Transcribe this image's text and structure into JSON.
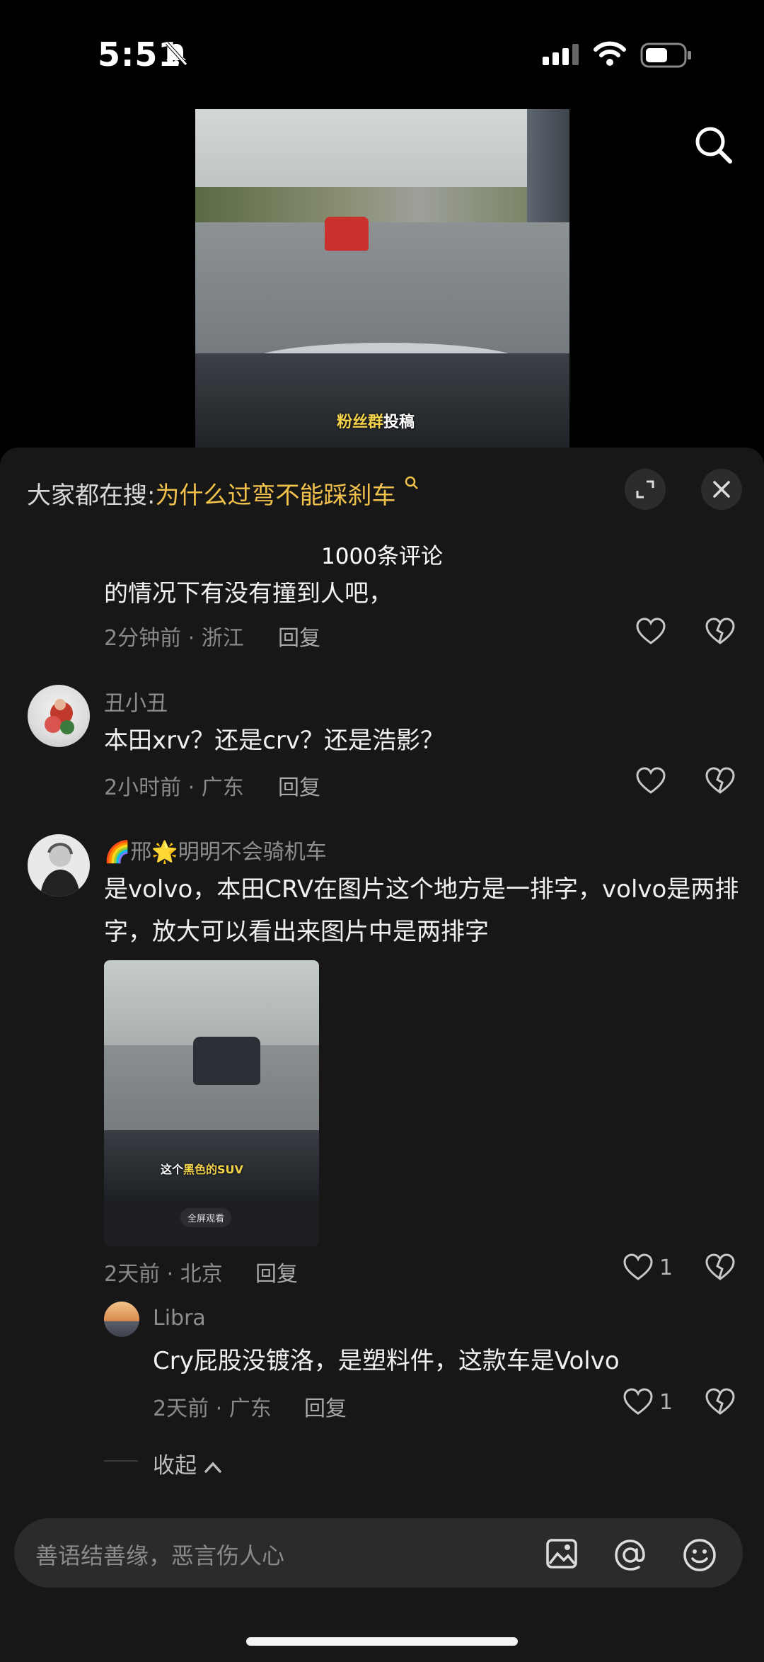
{
  "status": {
    "time": "5:51"
  },
  "video": {
    "caption_main": "粉丝群",
    "caption_sub": "投稿"
  },
  "hot_search": {
    "label": "大家都在搜:",
    "query": "为什么过弯不能踩刹车"
  },
  "comments_count": "1000条评论",
  "partial_comment": {
    "text": "的情况下有没有撞到人吧，",
    "meta": "2分钟前 · 浙江",
    "reply": "回复"
  },
  "comments": [
    {
      "name": "丑小丑",
      "text": "本田xrv？还是crv？还是浩影？",
      "meta": "2小时前 · 广东",
      "reply": "回复"
    },
    {
      "name": "🌈邢🌟明明不会骑机车",
      "text": "是volvo，本田CRV在图片这个地方是一排字，volvo是两排字，放大可以看出来图片中是两排字",
      "image_caption_main": "这个",
      "image_caption_highlight": "黑色的SUV",
      "image_button": "全屏观看",
      "meta": "2天前 · 北京",
      "reply": "回复",
      "likes": "1"
    }
  ],
  "sub_reply": {
    "name": "Libra",
    "text": "Cry屁股没镀洛，是塑料件，这款车是Volvo",
    "meta": "2天前 · 广东",
    "reply": "回复",
    "likes": "1"
  },
  "collapse_label": "收起",
  "input": {
    "placeholder": "善语结善缘，恶言伤人心"
  }
}
